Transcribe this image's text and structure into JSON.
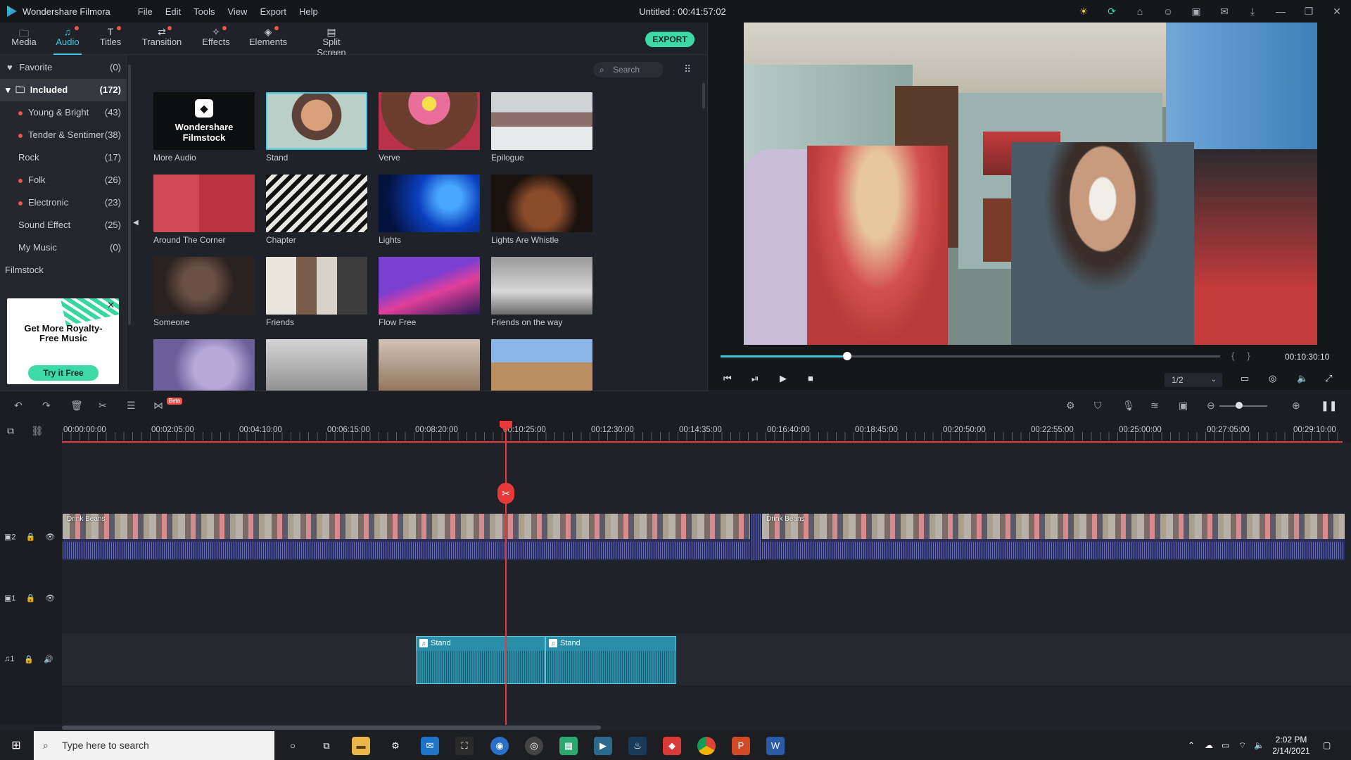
{
  "app": {
    "name": "Wondershare Filmora",
    "doc_title": "Untitled : 00:41:57:02"
  },
  "menu": [
    "File",
    "Edit",
    "Tools",
    "View",
    "Export",
    "Help"
  ],
  "tabs": [
    {
      "label": "Media",
      "icon": "folder-icon"
    },
    {
      "label": "Audio",
      "icon": "music-note-icon",
      "active": true
    },
    {
      "label": "Titles",
      "icon": "text-icon"
    },
    {
      "label": "Transition",
      "icon": "transition-icon"
    },
    {
      "label": "Effects",
      "icon": "effects-icon"
    },
    {
      "label": "Elements",
      "icon": "elements-icon"
    },
    {
      "label": "Split Screen",
      "icon": "split-screen-icon"
    }
  ],
  "export_label": "EXPORT",
  "library": {
    "favorite": {
      "label": "Favorite",
      "count": "(0)"
    },
    "included": {
      "label": "Included",
      "count": "(172)"
    },
    "items": [
      {
        "label": "Young & Bright",
        "count": "(43)"
      },
      {
        "label": "Tender & Sentimer",
        "count": "(38)"
      },
      {
        "label": "Rock",
        "count": "(17)"
      },
      {
        "label": "Folk",
        "count": "(26)"
      },
      {
        "label": "Electronic",
        "count": "(23)"
      },
      {
        "label": "Sound Effect",
        "count": "(25)"
      },
      {
        "label": "My Music",
        "count": "(0)"
      }
    ],
    "filmstock": "Filmstock",
    "promo": {
      "text": "Get More Royalty-Free Music",
      "button": "Try it Free"
    }
  },
  "search": {
    "placeholder": "Search"
  },
  "grid": {
    "filmstock_card": {
      "line1": "Wondershare",
      "line2": "Filmstock",
      "label": "More Audio"
    },
    "cards": [
      "Stand",
      "Verve",
      "Epilogue",
      "Around The Corner",
      "Chapter",
      "Lights",
      "Lights Are Whistle",
      "Someone",
      "Friends",
      "Flow Free",
      "Friends on the way"
    ],
    "selected": "Stand"
  },
  "preview": {
    "timecode": "00:10:30:10",
    "ratio": "1/2",
    "progress": 0.25
  },
  "ruler": [
    "00:00:00:00",
    "00:02:05:00",
    "00:04:10:00",
    "00:06:15:00",
    "00:08:20:00",
    "00:10:25:00",
    "00:12:30:00",
    "00:14:35:00",
    "00:16:40:00",
    "00:18:45:00",
    "00:20:50:00",
    "00:22:55:00",
    "00:25:00:00",
    "00:27:05:00",
    "00:29:10:00"
  ],
  "timeline": {
    "beta_badge": "Beta",
    "video_clip_1": "Drink Beans",
    "video_clip_2": "Drink Beans",
    "audio_clip_1": "Stand",
    "audio_clip_2": "Stand",
    "track_labels": {
      "v2": "2",
      "v1": "1",
      "a1": "1"
    }
  },
  "taskbar": {
    "search_placeholder": "Type here to search",
    "time": "2:02 PM",
    "date": "2/14/2021"
  },
  "colors": {
    "accent": "#3fc6e0",
    "export": "#3dd9a6",
    "playhead": "#e8393a"
  }
}
